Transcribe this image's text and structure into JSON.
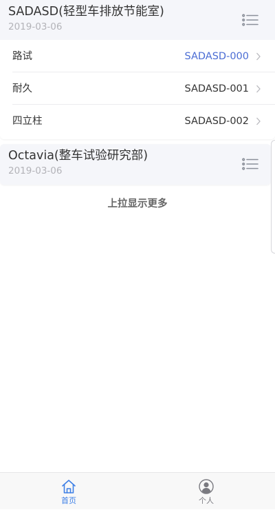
{
  "groups": [
    {
      "title": "SADASD(轻型车排放节能室)",
      "date": "2019-03-06",
      "items": [
        {
          "label": "路试",
          "value": "SADASD-000",
          "active": true
        },
        {
          "label": "耐久",
          "value": "SADASD-001",
          "active": false
        },
        {
          "label": "四立柱",
          "value": "SADASD-002",
          "active": false
        }
      ]
    },
    {
      "title": "Octavia(整车试验研究部)",
      "date": "2019-03-06",
      "items": []
    }
  ],
  "load_more": "上拉显示更多",
  "tabbar": {
    "home_label": "首页",
    "profile_label": "个人"
  },
  "colors": {
    "accent": "#4a6cd4",
    "header_bg": "#f5f6fa",
    "date_text": "#b3b3b8"
  }
}
